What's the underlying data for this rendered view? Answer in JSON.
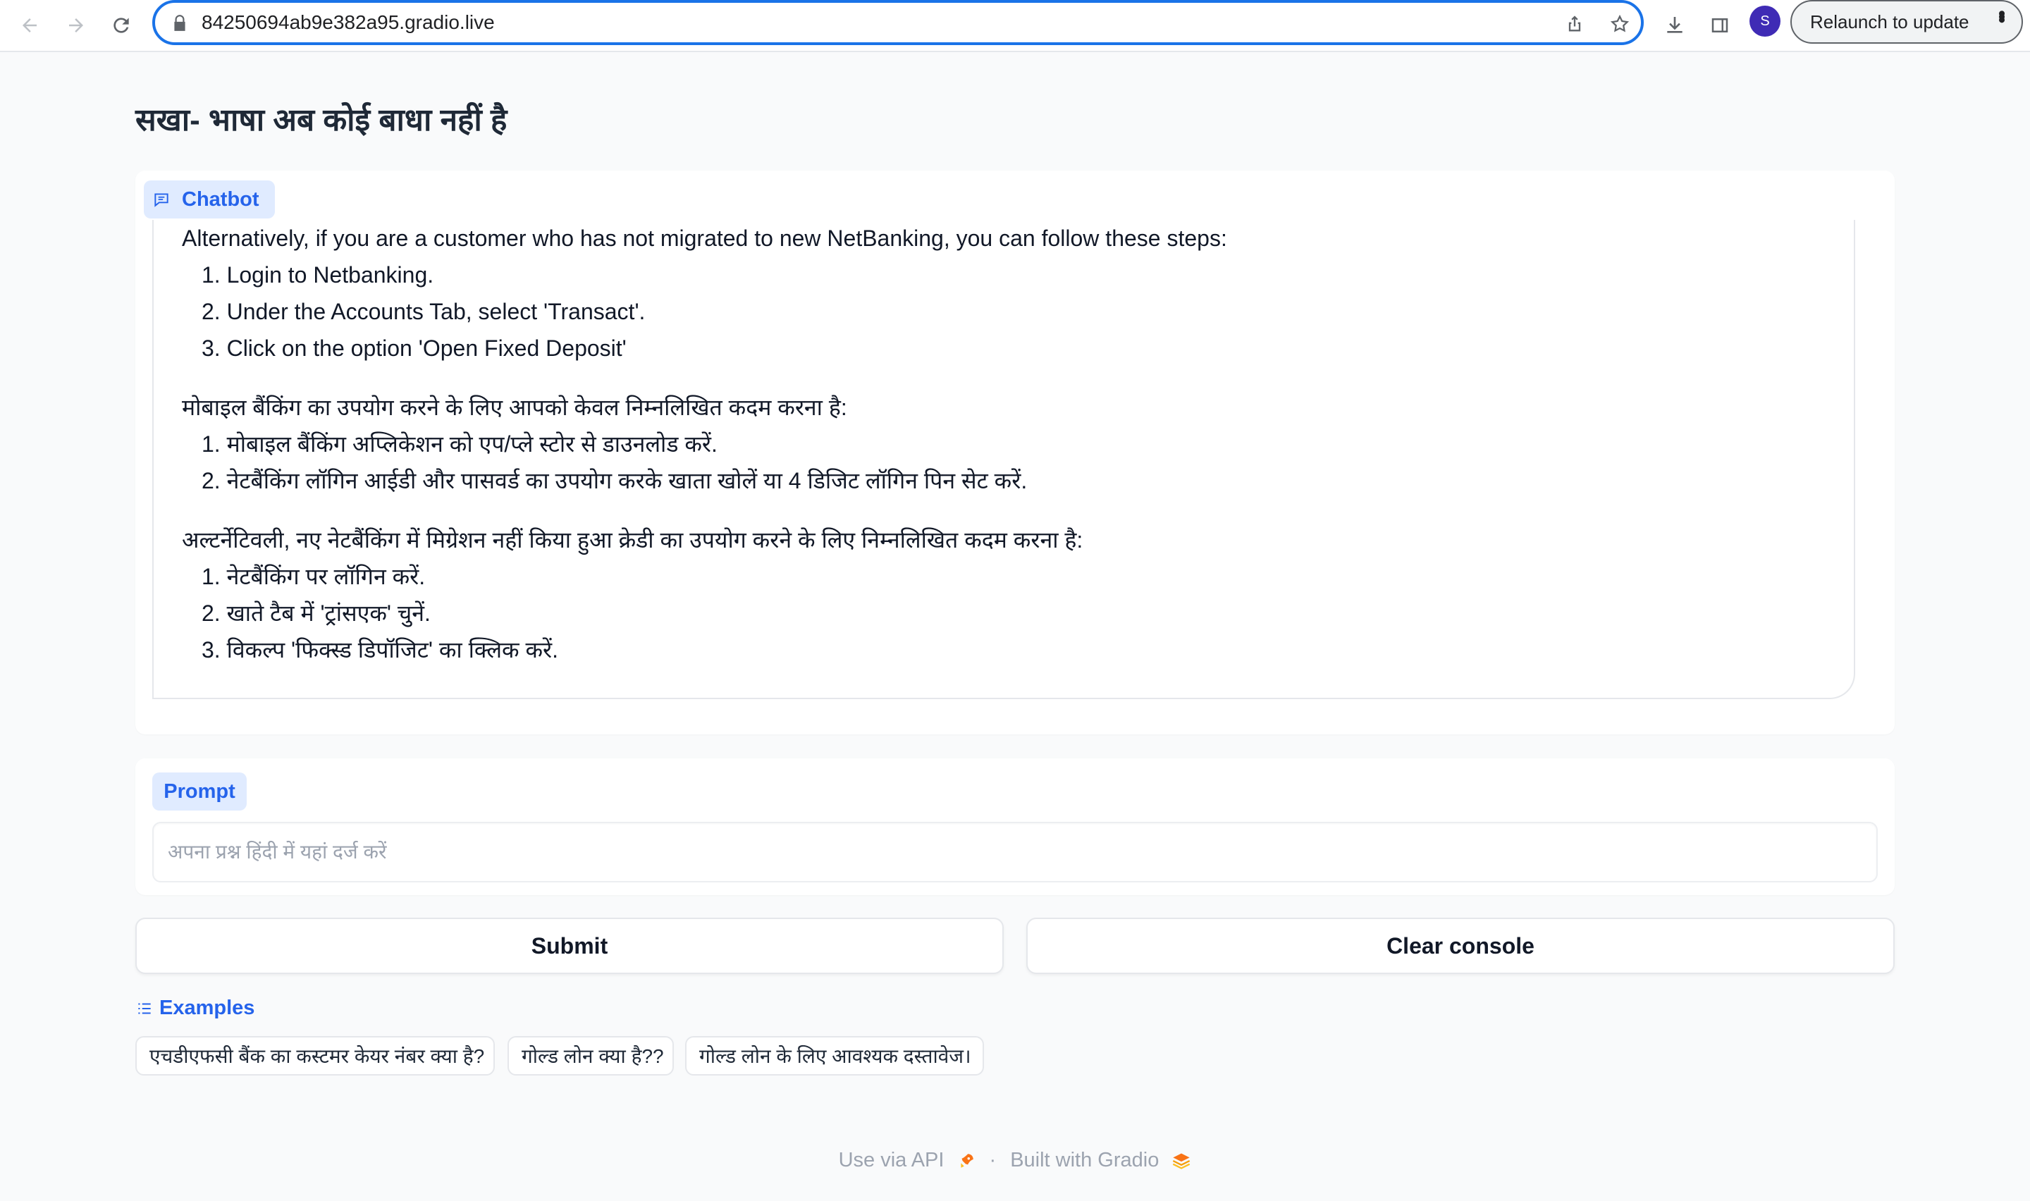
{
  "browser": {
    "url": "84250694ab9e382a95.gradio.live",
    "relaunch_label": "Relaunch to update",
    "profile_initial": "S"
  },
  "page": {
    "title": "सखा- भाषा अब कोई बाधा नहीं है"
  },
  "chatbot": {
    "label": "Chatbot",
    "english_intro": "Alternatively, if you are a customer who has not migrated to new NetBanking, you can follow these steps:",
    "english_steps": [
      "1. Login to Netbanking.",
      "2. Under the Accounts Tab, select 'Transact'.",
      "3. Click on the option 'Open Fixed Deposit'"
    ],
    "hindi_mobile_intro": "मोबाइल बैंकिंग का उपयोग करने के लिए आपको केवल निम्नलिखित कदम करना है:",
    "hindi_mobile_steps": [
      "1. मोबाइल बैंकिंग अप्लिकेशन को एप/प्ले स्टोर से डाउनलोड करें.",
      "2. नेटबैंकिंग लॉगिन आईडी और पासवर्ड का उपयोग करके खाता खोलें या 4 डिजिट लॉगिन पिन सेट करें."
    ],
    "hindi_alt_intro": "अल्टर्नेटिवली, नए नेटबैंकिंग में मिग्रेशन नहीं किया हुआ क्रेडी का उपयोग करने के लिए निम्नलिखित कदम करना है:",
    "hindi_alt_steps": [
      "1. नेटबैंकिंग पर लॉगिन करें.",
      "2. खाते टैब में 'ट्रांसएक' चुनें.",
      "3. विकल्प 'फिक्स्ड डिपॉजिट' का क्लिक करें."
    ]
  },
  "prompt": {
    "label": "Prompt",
    "placeholder": "अपना प्रश्न हिंदी में यहां दर्ज करें",
    "value": ""
  },
  "actions": {
    "submit_label": "Submit",
    "clear_label": "Clear console"
  },
  "examples": {
    "label": "Examples",
    "items": [
      "एचडीएफसी बैंक का कस्टमर केयर नंबर क्या है?",
      "गोल्ड लोन क्या है??",
      "गोल्ड लोन के लिए आवश्यक दस्तावेज।"
    ]
  },
  "footer": {
    "api_label": "Use via API",
    "separator": "·",
    "built_label": "Built with Gradio"
  },
  "colors": {
    "accent": "#2563eb",
    "chip_bg": "#e0ebff",
    "omnibox_border": "#1a73e8",
    "avatar": "#3f2bb5"
  }
}
